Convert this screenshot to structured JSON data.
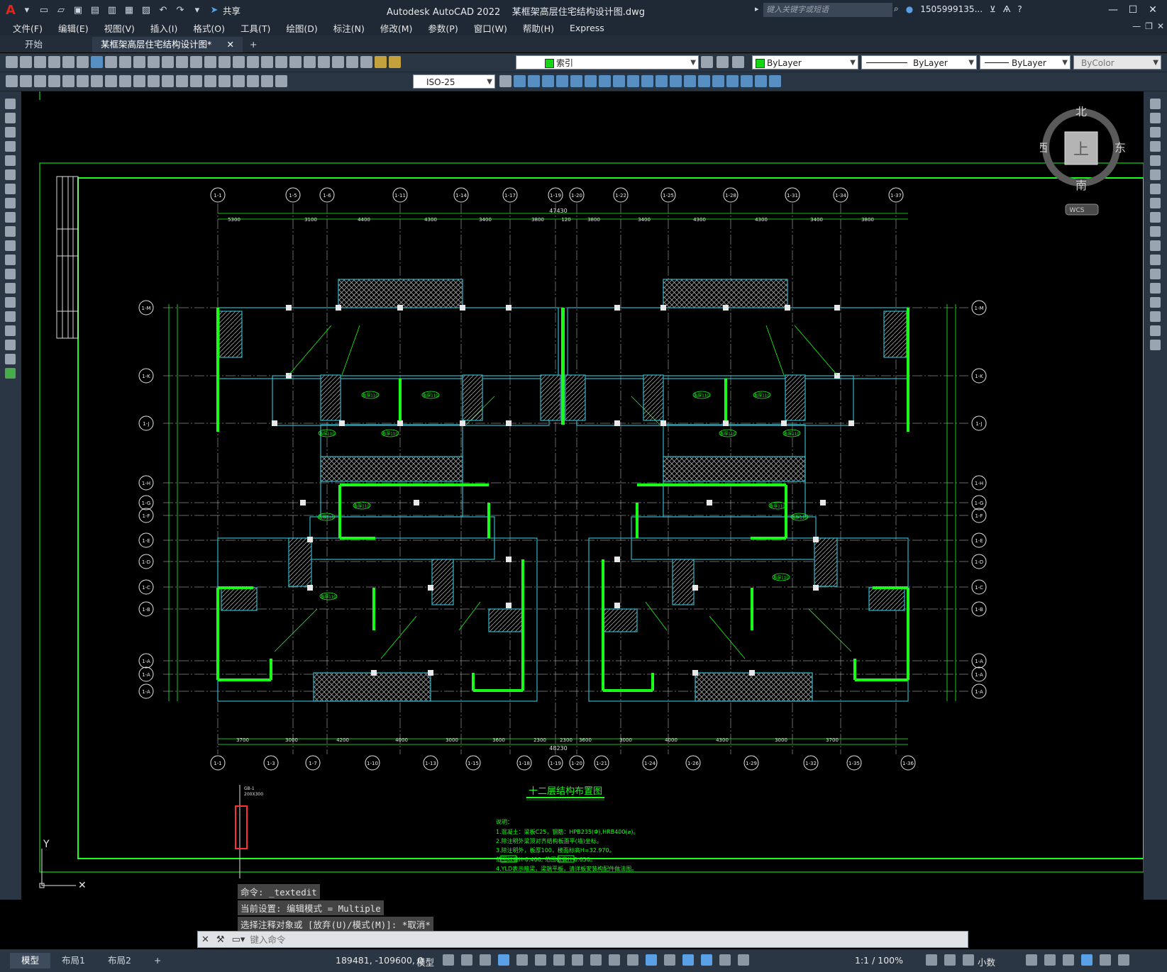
{
  "titlebar": {
    "app_title": "Autodesk AutoCAD 2022",
    "file_name": "某框架高层住宅结构设计图.dwg",
    "share_label": "共享",
    "search_placeholder": "键入关键字或短语",
    "user_name": "1505999135..."
  },
  "menu": {
    "items": [
      "文件(F)",
      "编辑(E)",
      "视图(V)",
      "插入(I)",
      "格式(O)",
      "工具(T)",
      "绘图(D)",
      "标注(N)",
      "修改(M)",
      "参数(P)",
      "窗口(W)",
      "帮助(H)",
      "Express"
    ]
  },
  "tabs": {
    "start": "开始",
    "active": "某框架高层住宅结构设计图*",
    "close": "✕",
    "add": "+"
  },
  "toolbar": {
    "layer_name": "索引",
    "color": "ByLayer",
    "linetype": "ByLayer",
    "lineweight": "ByLayer",
    "plotstyle": "ByColor",
    "dimstyle": "ISO-25"
  },
  "viewcube": {
    "north": "北",
    "south": "南",
    "east": "东",
    "west": "西",
    "face": "上",
    "ucs": "WCS"
  },
  "drawing": {
    "plan_title": "十二层结构布置图",
    "col_grid_top": [
      "1-1",
      "1-5",
      "1-6",
      "1-11",
      "1-14",
      "1-17",
      "1-19",
      "1-20",
      "1-22",
      "1-25",
      "1-28",
      "1-31",
      "1-34",
      "1-37"
    ],
    "col_grid_bottom": [
      "1-1",
      "1-3",
      "1-7",
      "1-10",
      "1-13",
      "1-15",
      "1-18",
      "1-19",
      "1-20",
      "1-21",
      "1-24",
      "1-26",
      "1-29",
      "1-32",
      "1-35",
      "1-36"
    ],
    "row_grid": [
      "1-M",
      "1-K",
      "1-J",
      "1-H",
      "1-G",
      "1-F",
      "1-E",
      "1-D",
      "1-C",
      "1-B",
      "1-A"
    ],
    "dim_top_total": "47430",
    "dim_bottom_total": "48230",
    "dim_top_segments": [
      "5300",
      "3100",
      "4400",
      "4300",
      "3400",
      "3800",
      "120",
      "3800",
      "3400",
      "4300",
      "4300",
      "3400",
      "3800"
    ],
    "dim_bottom_segments": [
      "3700",
      "3000",
      "4200",
      "4000",
      "3000",
      "3600",
      "2300",
      "2300",
      "3600",
      "3000",
      "4000",
      "4300",
      "3000",
      "3700"
    ],
    "slab_label": "板厚110",
    "note_title": "说明：",
    "notes": [
      "1.混凝土：梁板C25，钢筋：HPB235(Φ),HRB400(⌀)。",
      "2.除注明外梁顶对齐结构板面平(墙)坐标。",
      "3.除注明外，板厚100，楼面标高H=32.970。",
      "           范围标高H-0.400;      范围标高H-0.050。",
      "4.YLD表示暗梁，梁端平板，请详板安装构配件做法图。"
    ],
    "axis_y": "Y"
  },
  "command": {
    "history": [
      "命令: _textedit",
      "当前设置: 编辑模式 = Multiple",
      "选择注释对象或 [放弃(U)/模式(M)]: *取消*"
    ],
    "placeholder": "键入命令"
  },
  "status": {
    "tabs": [
      "模型",
      "布局1",
      "布局2"
    ],
    "add": "+",
    "coords": "189481, -109600, 0",
    "space": "模型",
    "scale": "1:1 / 100%",
    "units": "小数"
  },
  "colors": {
    "accent_green": "#18ff18",
    "wall_cyan": "#2fb6c8",
    "bg": "#000000"
  }
}
